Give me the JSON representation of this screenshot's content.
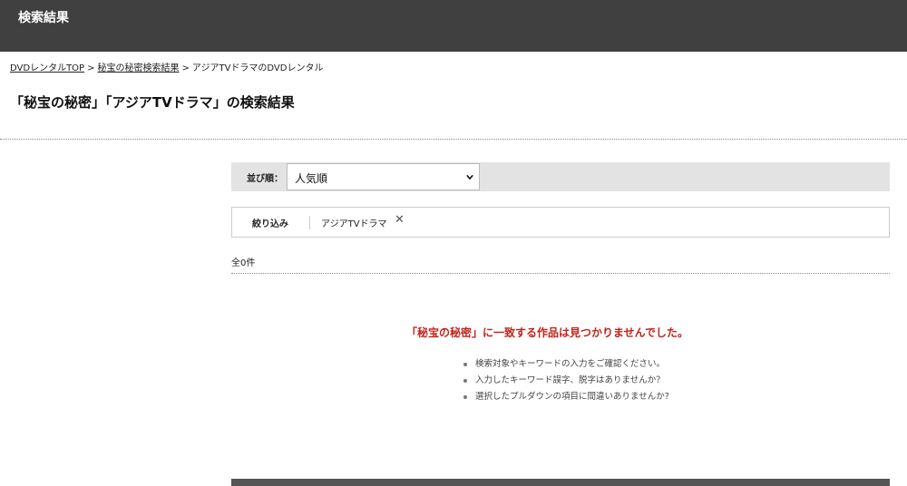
{
  "header": {
    "title": "検索結果"
  },
  "breadcrumb": {
    "items": [
      {
        "label": "DVDレンタルTOP"
      },
      {
        "label": "秘宝の秘密検索結果"
      },
      {
        "label": "アジアTVドラマのDVDレンタル"
      }
    ],
    "separator": ">"
  },
  "page": {
    "title": "「秘宝の秘密」「アジアTVドラマ」の検索結果"
  },
  "sort": {
    "label": "並び順：",
    "selected": "人気順",
    "chevron_icon": "chevron-down-icon"
  },
  "filter": {
    "label": "絞り込み",
    "active": "アジアTVドラマ",
    "remove_icon": "close-icon",
    "remove_symbol": "✕"
  },
  "results": {
    "count_text": "全0件",
    "no_match_message": "「秘宝の秘密」に一致する作品は見つかりませんでした。",
    "hints": [
      "検索対象やキーワードの入力をご確認ください。",
      "入力したキーワード誤字、脱字はありませんか？",
      "選択したプルダウンの項目に間違いありませんか?"
    ]
  },
  "colors": {
    "header_bg": "#404040",
    "error_text": "#c4221a",
    "sort_bar_bg": "#e3e3e3"
  }
}
